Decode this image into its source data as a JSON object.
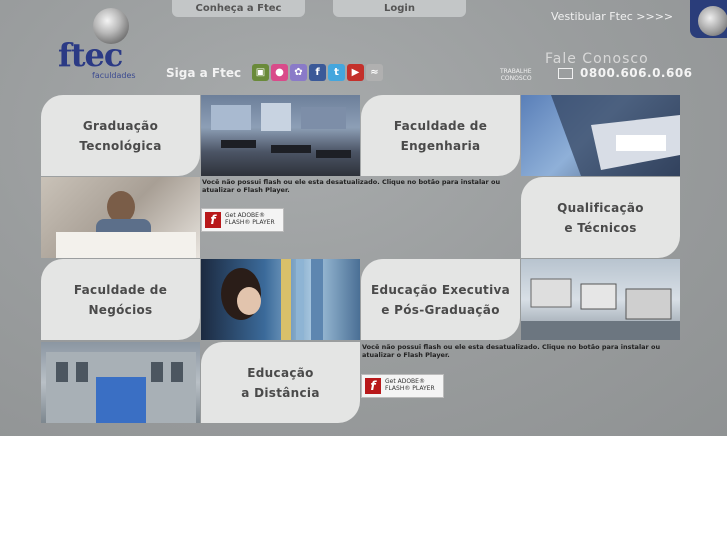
{
  "nav": {
    "tab1": "Conheça a Ftec",
    "tab2": "Login",
    "vestibular": "Vestibular Ftec >>>>"
  },
  "logo": {
    "name": "ftec",
    "sub": "faculdades"
  },
  "social": {
    "label": "Siga a Ftec",
    "icons": [
      "tv-icon",
      "orkut-icon",
      "flickr-icon",
      "facebook-icon",
      "twitter-icon",
      "youtube-icon",
      "rss-icon"
    ]
  },
  "contact": {
    "fale": "Fale Conosco",
    "trabalhe1": "TRABALHE",
    "trabalhe2": "CONOSCO",
    "phone": "0800.606.0.606"
  },
  "tiles": {
    "graduacao": [
      "Graduação",
      "Tecnológica"
    ],
    "engenharia": [
      "Faculdade de",
      "Engenharia"
    ],
    "qualificacao": [
      "Qualificação",
      "e Técnicos"
    ],
    "negocios": [
      "Faculdade de",
      "Negócios"
    ],
    "executiva": [
      "Educação Executiva",
      "e Pós-Graduação"
    ],
    "distancia": [
      "Educação",
      "a Distância"
    ]
  },
  "flash": {
    "msg1a": "Você não possui flash ou ele esta desatualizado. Clique no botão para instalar ou",
    "msg1b": "atualizar o Flash Player.",
    "btn1": "Get ADOBE® FLASH® PLAYER",
    "msg2a": "Você não possui flash ou ele esta desatualizado. Clique no botão para instalar ou",
    "msg2b": "atualizar o Flash Player.",
    "btn2": "Get ADOBE® FLASH® PLAYER"
  },
  "colors": {
    "brand": "#2b3a85",
    "tile": "#e4e5e4",
    "bg": "#9c9fa0",
    "flash": "#b8181a"
  }
}
